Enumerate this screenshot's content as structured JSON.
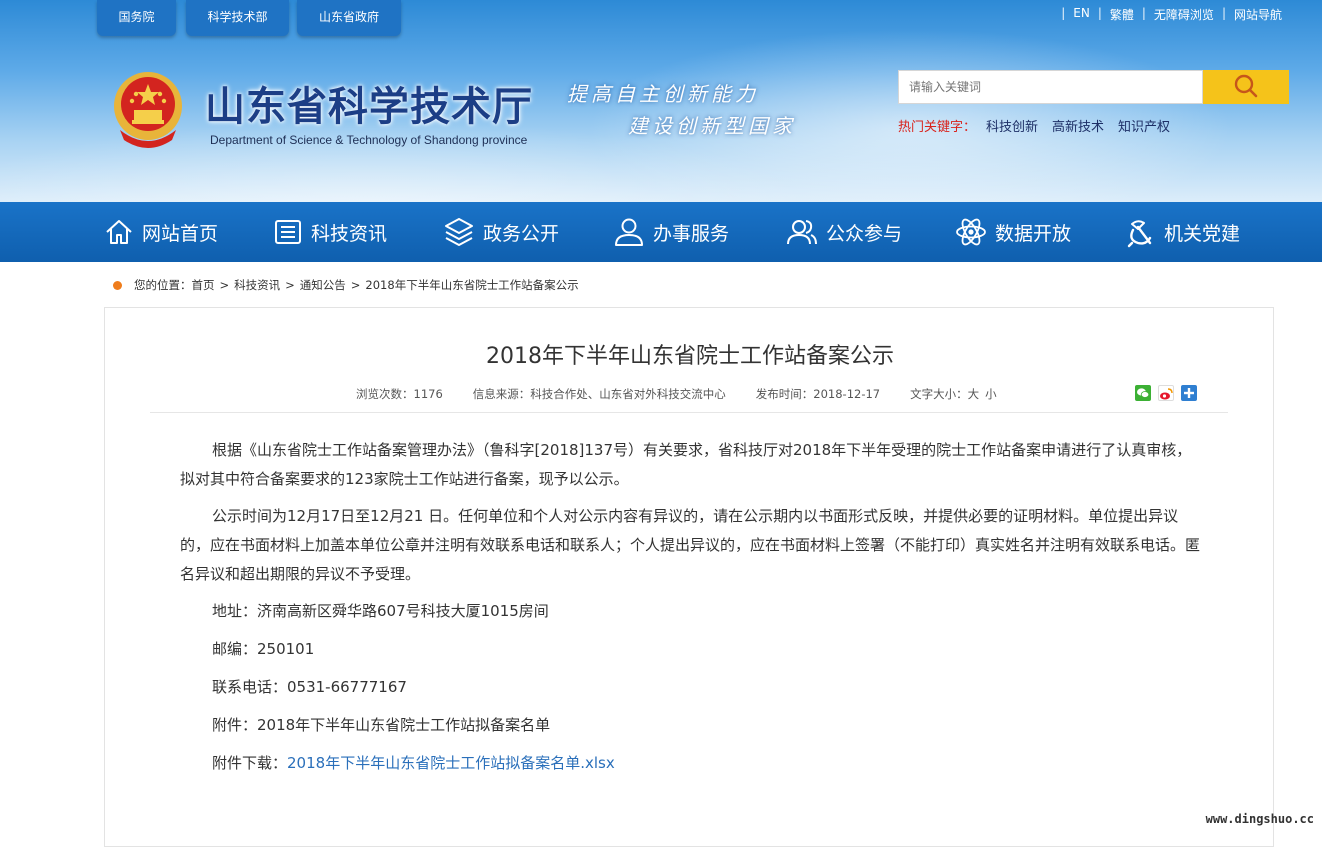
{
  "top_tabs": [
    "国务院",
    "科学技术部",
    "山东省政府"
  ],
  "top_links": [
    "EN",
    "繁體",
    "无障碍浏览",
    "网站导航"
  ],
  "site": {
    "title": "山东省科学技术厅",
    "subtitle": "Department of Science & Technology of Shandong province",
    "slogan_line1": "提高自主创新能力",
    "slogan_line2": "建设创新型国家"
  },
  "search": {
    "placeholder": "请输入关键词",
    "button_icon": "search-icon"
  },
  "hot_keywords": {
    "label": "热门关键字：",
    "items": [
      "科技创新",
      "高新技术",
      "知识产权"
    ]
  },
  "nav": [
    {
      "label": "网站首页",
      "icon": "home-icon"
    },
    {
      "label": "科技资讯",
      "icon": "news-icon"
    },
    {
      "label": "政务公开",
      "icon": "layers-icon"
    },
    {
      "label": "办事服务",
      "icon": "user-icon"
    },
    {
      "label": "公众参与",
      "icon": "users-icon"
    },
    {
      "label": "数据开放",
      "icon": "atom-icon"
    },
    {
      "label": "机关党建",
      "icon": "party-icon"
    }
  ],
  "breadcrumb": {
    "prefix": "您的位置：",
    "items": [
      "首页",
      "科技资讯",
      "通知公告",
      "2018年下半年山东省院士工作站备案公示"
    ]
  },
  "article": {
    "title": "2018年下半年山东省院士工作站备案公示",
    "views": "浏览次数：1176",
    "source": "信息来源：科技合作处、山东省对外科技交流中心",
    "date": "发布时间：2018-12-17",
    "font_size_label": "文字大小：",
    "font_big": "大",
    "font_small": "小",
    "share_icons": [
      "wechat-icon",
      "weibo-icon",
      "plus-share-icon"
    ],
    "para1": "根据《山东省院士工作站备案管理办法》（鲁科字[2018]137号）有关要求，省科技厅对2018年下半年受理的院士工作站备案申请进行了认真审核，拟对其中符合备案要求的123家院士工作站进行备案，现予以公示。",
    "para2": "公示时间为12月17日至12月21 日。任何单位和个人对公示内容有异议的，请在公示期内以书面形式反映，并提供必要的证明材料。单位提出异议的，应在书面材料上加盖本单位公章并注明有效联系电话和联系人；个人提出异议的，应在书面材料上签署（不能打印）真实姓名并注明有效联系电话。匿名异议和超出期限的异议不予受理。",
    "address": "地址：济南高新区舜华路607号科技大厦1015房间",
    "postcode": "邮编：250101",
    "phone": "联系电话：0531-66777167",
    "attachment": "附件：2018年下半年山东省院士工作站拟备案名单",
    "download_label": "附件下载：",
    "download_link": "2018年下半年山东省院士工作站拟备案名单.xlsx"
  },
  "watermark": "www.dingshuo.cc",
  "colors": {
    "nav_blue": "#1167b8",
    "accent_yellow": "#f5c31a",
    "hot_red": "#d9231c",
    "link_blue": "#2a6fba",
    "breadcrumb_dot": "#ef7d1c"
  }
}
